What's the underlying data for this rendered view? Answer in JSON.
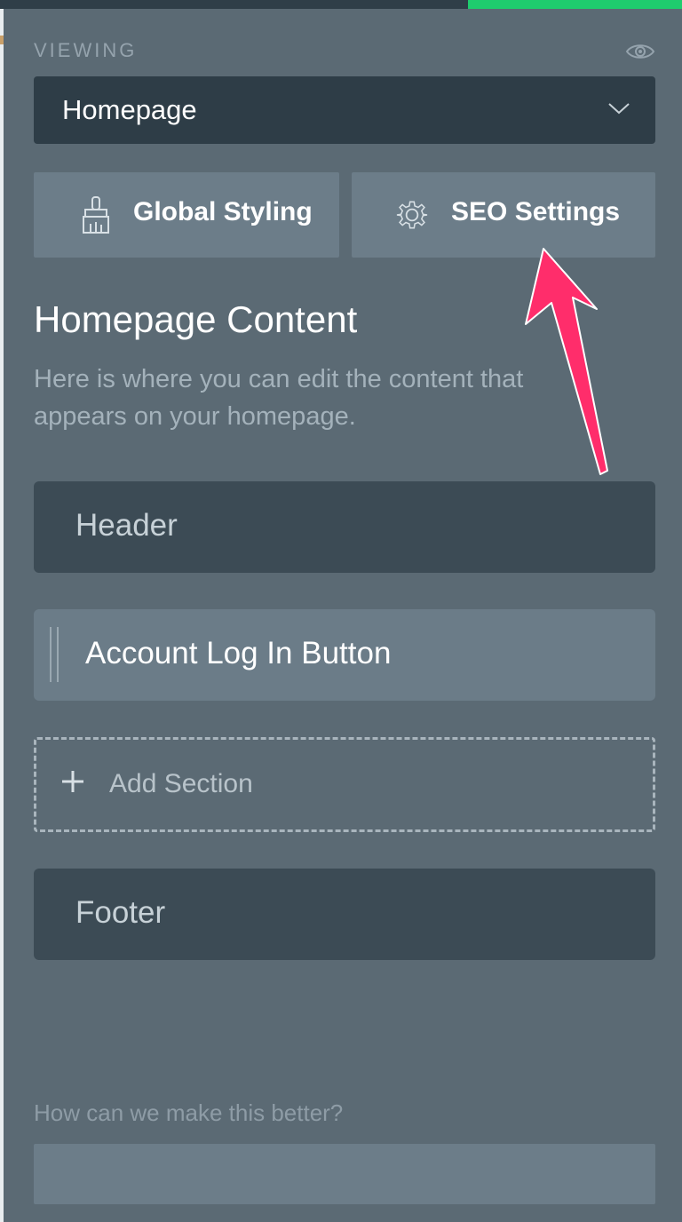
{
  "viewing": {
    "label": "VIEWING",
    "selected": "Homepage",
    "view_icon": "eye-icon"
  },
  "toolbar": {
    "global_styling": {
      "label": "Global Styling",
      "icon": "paintbrush-icon"
    },
    "seo_settings": {
      "label": "SEO Settings",
      "icon": "gear-icon"
    }
  },
  "content": {
    "title": "Homepage Content",
    "description": "Here is where you can edit the content that appears on your homepage."
  },
  "sections": {
    "header": "Header",
    "account_button": "Account Log In Button",
    "add": "Add Section",
    "footer": "Footer"
  },
  "feedback": {
    "label": "How can we make this better?",
    "value": ""
  },
  "colors": {
    "panel_bg": "#5b6a74",
    "select_bg": "#2e3d47",
    "button_bg": "#6c7d89",
    "section_dark_bg": "#3c4b55",
    "accent_green": "#1fcc6e",
    "annotation_arrow": "#ff2d6b"
  }
}
